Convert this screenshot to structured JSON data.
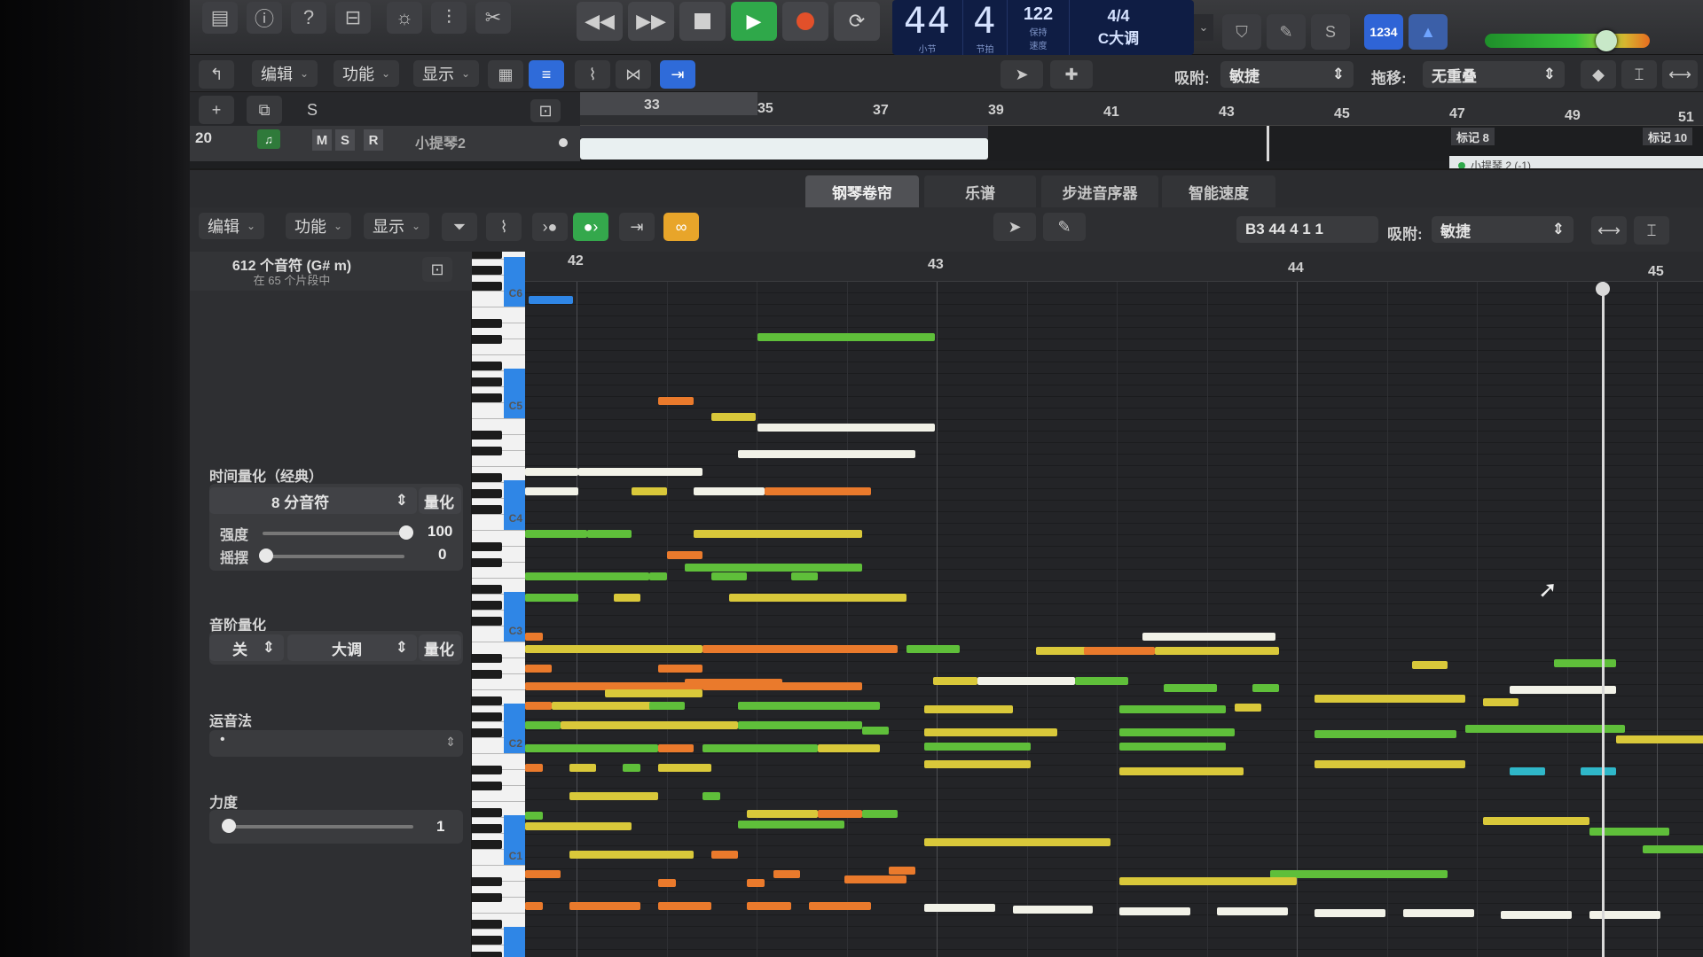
{
  "control_bar": {
    "lcd": {
      "bar": "44",
      "beat": "4",
      "bar_caption": "小节",
      "beat_caption": "节拍",
      "tempo": "122",
      "tempo_caption": "保持",
      "tempo_caption2": "速度",
      "signature": "4/4",
      "key": "C大调"
    },
    "count_in_label": "1234"
  },
  "tracks_toolbar": {
    "edit_label": "编辑",
    "functions_label": "功能",
    "view_label": "显示",
    "snap_label": "吸附:",
    "snap_value": "敏捷",
    "drag_label": "拖移:",
    "drag_value": "无重叠"
  },
  "tracks": {
    "header_buttons": {
      "add": "+",
      "solo_btn": "S"
    },
    "track_number": "20",
    "track_mute": "M",
    "track_solo": "S",
    "track_record": "R",
    "track_name": "小提琴2",
    "ruler_bars": [
      "33",
      "35",
      "37",
      "39",
      "41",
      "43",
      "45",
      "47",
      "49",
      "51"
    ],
    "marker_a": "标记 8",
    "marker_b": "标记 10",
    "region_tag": "小提琴 2 (-1)"
  },
  "editor": {
    "tabs": [
      "钢琴卷帘",
      "乐谱",
      "步进音序器",
      "智能速度"
    ],
    "edit_label": "编辑",
    "functions_label": "功能",
    "view_label": "显示",
    "position": "B3  44 4 1 1",
    "snap_label": "吸附:",
    "snap_value": "敏捷",
    "ruler_bars": [
      "42",
      "43",
      "44",
      "45"
    ]
  },
  "inspector": {
    "note_count": "612 个音符 (G# m)",
    "region_count": "在 65 个片段中",
    "time_quantize_heading": "时间量化（经典）",
    "time_quantize_value": "8 分音符",
    "quantize_btn": "量化",
    "strength_label": "强度",
    "strength_value": "100",
    "swing_label": "摇摆",
    "swing_value": "0",
    "scale_quantize_heading": "音阶量化",
    "scale_off": "关",
    "scale_mode": "大调",
    "scale_quantize_btn": "量化",
    "articulation_heading": "运音法",
    "articulation_value": "•",
    "velocity_heading": "力度",
    "velocity_value": "1"
  },
  "piano": {
    "labels": [
      "C6",
      "C5",
      "C4",
      "C3",
      "C2",
      "C1"
    ]
  },
  "colors": {
    "green": "#5fbf3a",
    "yellow": "#d9c83a",
    "orange": "#ea7a2c",
    "white": "#f2f2e8",
    "cyan": "#2fb7c9",
    "blue_accent": "#2f6bd9",
    "play_green": "#2fa84a",
    "record_red": "#e2502a"
  }
}
